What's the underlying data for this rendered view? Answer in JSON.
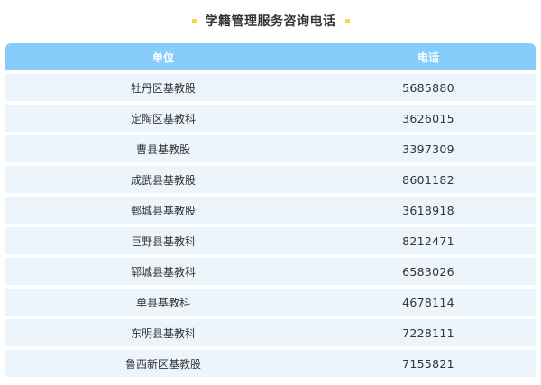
{
  "title": "学籍管理服务咨询电话",
  "colors": {
    "header_bg": "#87cdfb",
    "row_bg": "#edf5fc",
    "title_dot": "#f5d64a"
  },
  "table": {
    "headers": [
      "单位",
      "电话"
    ],
    "rows": [
      {
        "unit": "牡丹区基教股",
        "phone": "5685880"
      },
      {
        "unit": "定陶区基教科",
        "phone": "3626015"
      },
      {
        "unit": "曹县基教股",
        "phone": "3397309"
      },
      {
        "unit": "成武县基教股",
        "phone": "8601182"
      },
      {
        "unit": "鄄城县基教股",
        "phone": "3618918"
      },
      {
        "unit": "巨野县基教科",
        "phone": "8212471"
      },
      {
        "unit": "郓城县基教科",
        "phone": "6583026"
      },
      {
        "unit": "单县基教科",
        "phone": "4678114"
      },
      {
        "unit": "东明县基教科",
        "phone": "7228111"
      },
      {
        "unit": "鲁西新区基教股",
        "phone": "7155821"
      }
    ]
  }
}
